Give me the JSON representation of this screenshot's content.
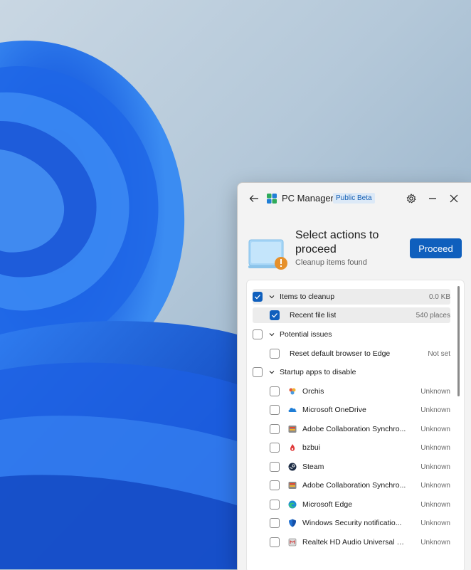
{
  "window": {
    "app_title": "PC Manager",
    "badge": "Public Beta",
    "icons": {
      "back": "back-arrow-icon",
      "settings": "gear-icon",
      "minimize": "minimize-icon",
      "close": "close-icon"
    }
  },
  "header": {
    "title": "Select actions to proceed",
    "subtitle": "Cleanup items found",
    "proceed_label": "Proceed"
  },
  "colors": {
    "accent": "#0f5fbd",
    "warning": "#e6902b"
  },
  "groups": {
    "cleanup": {
      "label": "Items to cleanup",
      "value": "0.0 KB",
      "checked": true
    },
    "recent": {
      "label": "Recent file list",
      "value": "540 places",
      "checked": true
    },
    "issues": {
      "label": "Potential issues",
      "checked": false
    },
    "reset": {
      "label": "Reset default browser to Edge",
      "value": "Not set",
      "checked": false
    },
    "startup": {
      "label": "Startup apps to disable",
      "checked": false
    }
  },
  "apps": [
    {
      "name": "Orchis",
      "status": "Unknown",
      "icon": "orchis-icon"
    },
    {
      "name": "Microsoft OneDrive",
      "status": "Unknown",
      "icon": "onedrive-icon"
    },
    {
      "name": "Adobe Collaboration Synchro...",
      "status": "Unknown",
      "icon": "adobe-icon"
    },
    {
      "name": "bzbui",
      "status": "Unknown",
      "icon": "bzbui-icon"
    },
    {
      "name": "Steam",
      "status": "Unknown",
      "icon": "steam-icon"
    },
    {
      "name": "Adobe Collaboration Synchro...",
      "status": "Unknown",
      "icon": "adobe-icon"
    },
    {
      "name": "Microsoft Edge",
      "status": "Unknown",
      "icon": "edge-icon"
    },
    {
      "name": "Windows Security notificatio...",
      "status": "Unknown",
      "icon": "shield-icon"
    },
    {
      "name": "Realtek HD Audio Universal S...",
      "status": "Unknown",
      "icon": "realtek-icon"
    }
  ]
}
